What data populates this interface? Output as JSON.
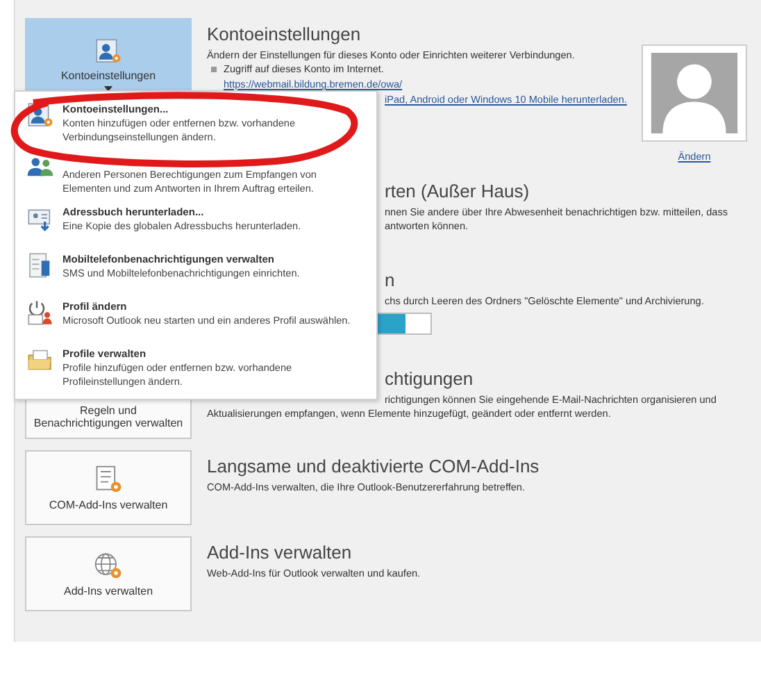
{
  "sections": [
    {
      "tile": {
        "label": "Kontoeinstellungen",
        "selected": true,
        "kind": "account"
      },
      "heading": {
        "text": "Kontoeinstellungen",
        "kind": "full"
      },
      "lines": [
        {
          "kind": "text",
          "text": "Ändern der Einstellungen für dieses Konto oder Einrichten weiterer Verbindungen."
        },
        {
          "kind": "bullet",
          "text": "Zugriff auf dieses Konto im Internet."
        },
        {
          "kind": "link",
          "text": "https://webmail.bildung.bremen.de/owa/"
        },
        {
          "kind": "link_fragment",
          "text": "iPad, Android oder Windows 10 Mobile herunterladen."
        }
      ],
      "picture": {
        "link": "Ändern"
      }
    },
    {
      "heading": {
        "text": "rten (Außer Haus)",
        "kind": "fragment"
      },
      "lines": [
        {
          "kind": "fragment",
          "text": "nnen Sie andere über Ihre Abwesenheit benachrichtigen bzw. mitteilen, dass"
        },
        {
          "kind": "fragment",
          "text": "antworten können."
        }
      ]
    },
    {
      "heading": {
        "text": "n",
        "kind": "fragment"
      },
      "lines": [
        {
          "kind": "fragment",
          "text": "chs durch Leeren des Ordners \"Gelöschte Elemente\" und Archivierung."
        }
      ],
      "progress": {
        "level": 0.89
      }
    },
    {
      "tile": {
        "label": "Regeln und Benachrichtigungen verwalten",
        "selected": false,
        "kind": "plain"
      },
      "heading": {
        "text": "chtigungen",
        "kind": "fragment"
      },
      "lines": [
        {
          "kind": "fragment",
          "text": "richtigungen können Sie eingehende E-Mail-Nachrichten organisieren und"
        },
        {
          "kind": "text",
          "text": "Aktualisierungen empfangen, wenn Elemente hinzugefügt, geändert oder entfernt werden."
        }
      ]
    },
    {
      "tile": {
        "label": "COM-Add-Ins verwalten",
        "selected": false,
        "kind": "list"
      },
      "heading": {
        "text": "Langsame und deaktivierte COM-Add-Ins",
        "kind": "full"
      },
      "lines": [
        {
          "kind": "text",
          "text": "COM-Add-Ins verwalten, die Ihre Outlook-Benutzererfahrung betreffen."
        }
      ]
    },
    {
      "tile": {
        "label": "Add-Ins verwalten",
        "selected": false,
        "kind": "globe"
      },
      "heading": {
        "text": "Add-Ins verwalten",
        "kind": "full"
      },
      "lines": [
        {
          "kind": "text",
          "text": "Web-Add-Ins für Outlook verwalten und kaufen."
        }
      ]
    }
  ],
  "menu": {
    "items": [
      {
        "kind": "account",
        "title": "Kontoeinstellungen...",
        "description": "Konten hinzufügen oder entfernen bzw. vorhandene Verbindungseinstellungen ändern."
      },
      {
        "kind": "people",
        "description": "Anderen Personen Berechtigungen zum Empfangen von Elementen und zum Antworten in Ihrem Auftrag erteilen."
      },
      {
        "kind": "addressbook",
        "title": "Adressbuch herunterladen...",
        "description": "Eine Kopie des globalen Adressbuchs herunterladen."
      },
      {
        "kind": "phone",
        "title": "Mobiltelefonbenachrichtigungen verwalten",
        "description": "SMS und Mobiltelefonbenachrichtigungen einrichten."
      },
      {
        "kind": "profile",
        "title": "Profil ändern",
        "description": "Microsoft Outlook neu starten und ein anderes Profil auswählen."
      },
      {
        "kind": "folder",
        "title": "Profile verwalten",
        "description": "Profile hinzufügen oder entfernen bzw. vorhandene Profileinstellungen ändern."
      }
    ]
  },
  "annotation": {
    "kind": "circle",
    "color": "#e01a1a"
  }
}
